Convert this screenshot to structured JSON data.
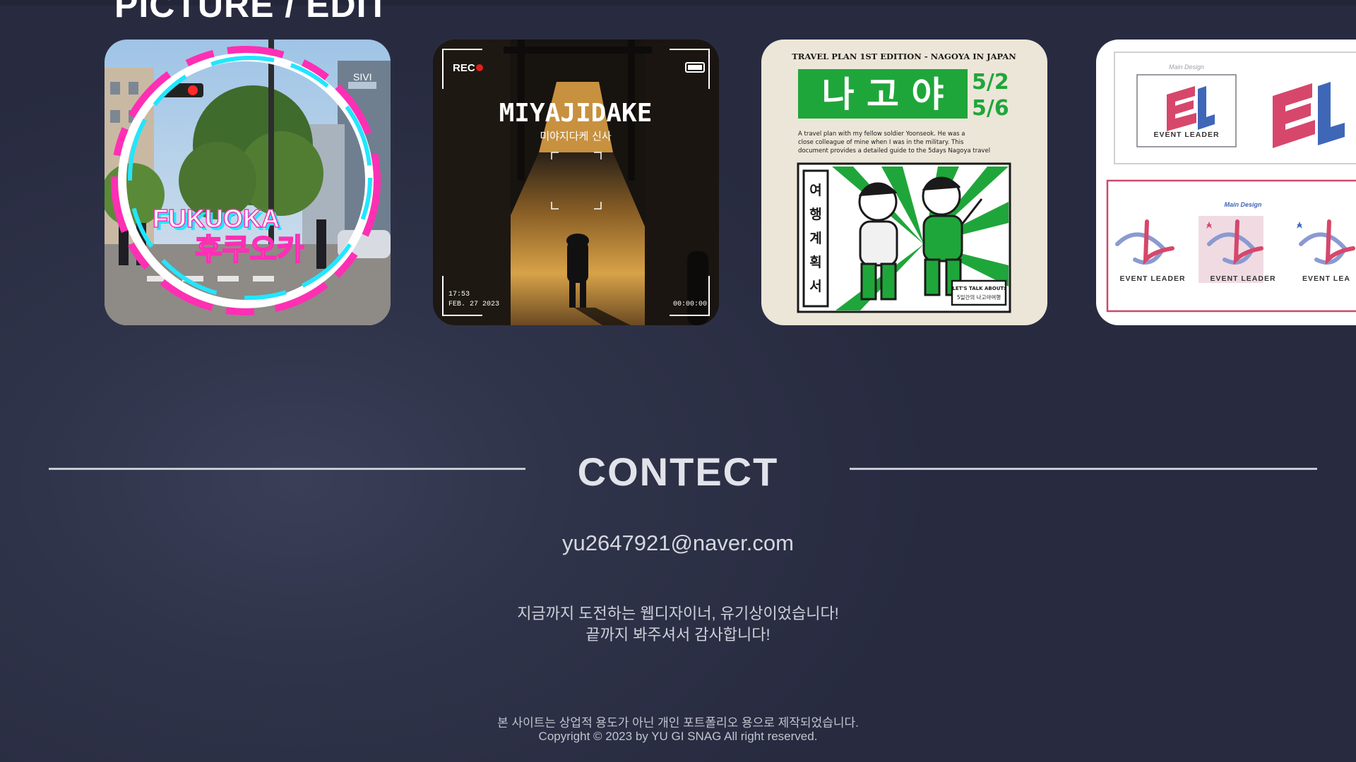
{
  "section": {
    "title": "PICTURE / EDIT"
  },
  "cards": [
    {
      "overlay_en": "FUKUOKA",
      "overlay_ko": "후쿠오카",
      "sign": "SIVI"
    },
    {
      "rec": "REC",
      "title": "MIYAJIDAKE",
      "subtitle": "미야지다케 신사",
      "time": "17:53",
      "date": "FEB. 27 2023",
      "timecode": "00:00:00"
    },
    {
      "header": "TRAVEL PLAN 1ST EDITION - NAGOYA IN JAPAN",
      "title_ko": "나 고 야",
      "date1": "5/2",
      "date2": "5/6",
      "desc1": "A travel plan with my fellow soldier Yoonseok. He was a",
      "desc2": "close colleague of mine when I was in the military. This",
      "desc3": "document provides a detailed guide to the 5days Nagoya travel",
      "vertical": [
        "여",
        "행",
        "계",
        "획",
        "서"
      ],
      "badge1": "LET'S TALK ABOUT:",
      "badge2": "5일간의 나고야여행"
    },
    {
      "main_design_1": "Main Design",
      "logo_label": "EVENT LEADER",
      "main_design_2": "Main Design",
      "variants": [
        "EVENT LEADER",
        "EVENT LEADER",
        "EVENT LEA"
      ]
    }
  ],
  "contact": {
    "title": "CONTECT",
    "email": "yu2647921@naver.com",
    "message_line1": "지금까지 도전하는 웹디자이너, 유기상이었습니다!",
    "message_line2": "끝까지 봐주셔서 감사합니다!"
  },
  "footer": {
    "line1": "본 사이트는 상업적 용도가 아닌 개인 포트폴리오 용으로 제작되었습니다.",
    "line2": "Copyright © 2023 by YU GI SNAG All right reserved."
  },
  "colors": {
    "background": "#2b2f45",
    "accent_green": "#1fa63a",
    "accent_pink": "#d6476b",
    "rec_red": "#e0201e"
  }
}
